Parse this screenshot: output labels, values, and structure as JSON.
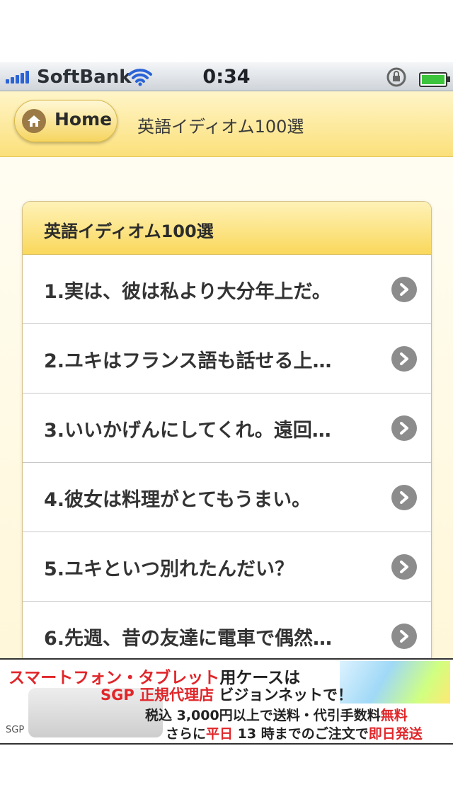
{
  "status_bar": {
    "carrier": "SoftBank",
    "time": "0:34"
  },
  "header": {
    "home_label": "Home",
    "title": "英語イディオム100選"
  },
  "card": {
    "title": "英語イディオム100選",
    "items": [
      {
        "label": "1.実は、彼は私より大分年上だ。"
      },
      {
        "label": "2.ユキはフランス語も話せる上…"
      },
      {
        "label": "3.いいかげんにしてくれ。遠回…"
      },
      {
        "label": "4.彼女は料理がとてもうまい。"
      },
      {
        "label": "5.ユキといつ別れたんだい？"
      },
      {
        "label": "6.先週、昔の友達に電車で偶然…"
      }
    ]
  },
  "ad": {
    "line1_red": "スマートフォン・タブレット",
    "line1_black": "用ケースは",
    "line2_red": "SGP 正規代理店",
    "line2_black": " ビジョンネットで！",
    "line3_black": "税込 3,000円以上で送料・代引手数料",
    "line3_red": "無料",
    "line4_black_a": "さらに",
    "line4_red_a": "平日",
    "line4_black_b": " 13 時までのご注文で",
    "line4_red_b": "即日発送",
    "logo": "SGP"
  },
  "colors": {
    "header_yellow": "#fbe07a",
    "accent_red": "#e0262a",
    "signal_blue": "#2a63d6"
  }
}
